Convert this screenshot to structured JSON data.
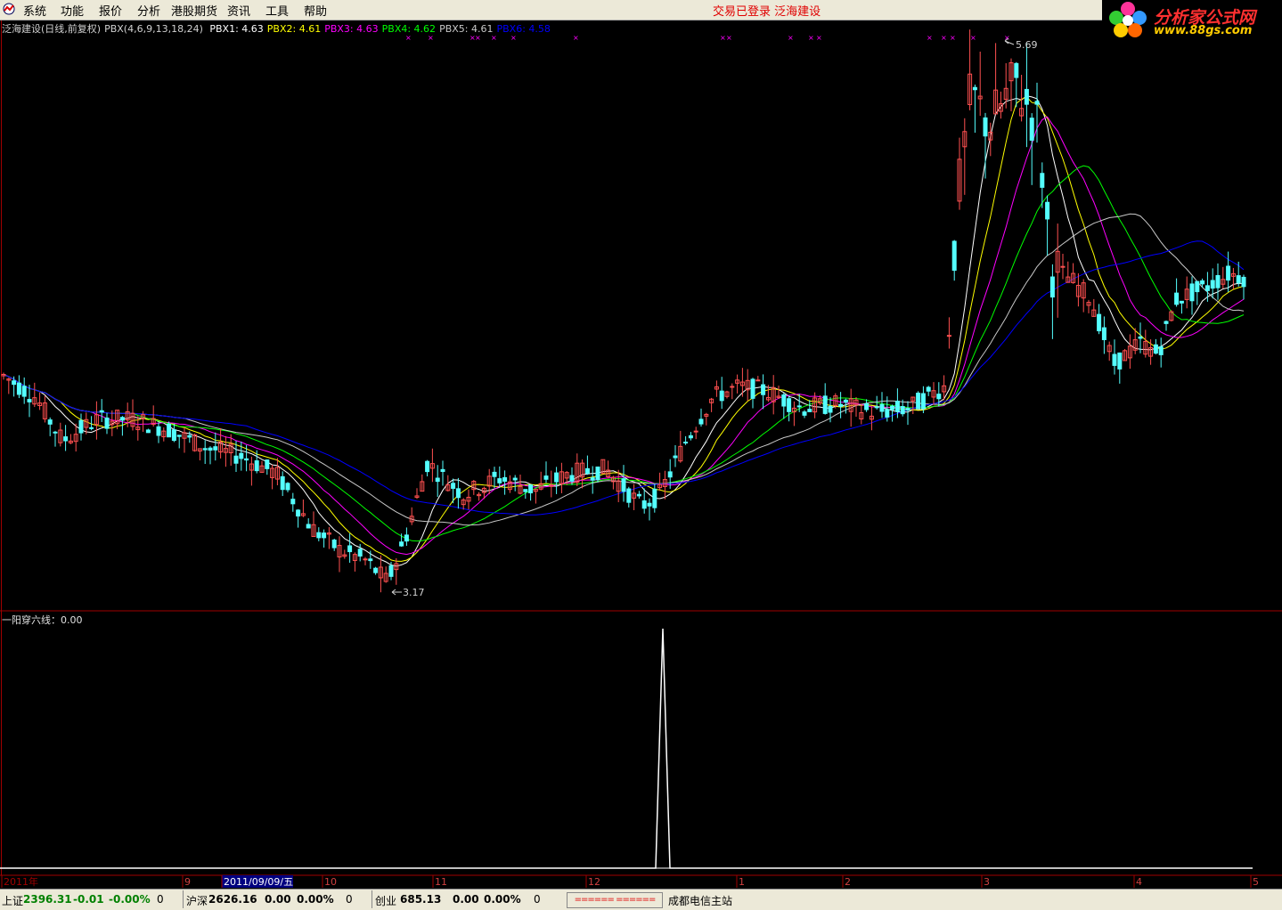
{
  "menu": {
    "items": [
      "系统",
      "功能",
      "报价",
      "分析",
      "港股期货",
      "资讯",
      "工具",
      "帮助"
    ],
    "status": "交易已登录  泛海建设"
  },
  "brand": {
    "name": "分析家公式网",
    "url": "www.88gs.com"
  },
  "indicator": {
    "title": "泛海建设(日线,前复权)",
    "formula": "PBX(4,6,9,13,18,24)",
    "lines": [
      {
        "label": "PBX1:",
        "value": "4.63",
        "color": "#ffffff"
      },
      {
        "label": "PBX2:",
        "value": "4.61",
        "color": "#ffff00"
      },
      {
        "label": "PBX3:",
        "value": "4.63",
        "color": "#ff00ff"
      },
      {
        "label": "PBX4:",
        "value": "4.62",
        "color": "#00ff00"
      },
      {
        "label": "PBX5:",
        "value": "4.61",
        "color": "#c8c8c8"
      },
      {
        "label": "PBX6:",
        "value": "4.58",
        "color": "#0000ff"
      }
    ],
    "high_label": "5.69",
    "low_label": "3.17"
  },
  "sub_indicator": {
    "label": "一阳穿六线：0.00"
  },
  "time_axis": {
    "labels": [
      "2011年",
      "9",
      "2011/09/09/五",
      "10",
      "11",
      "12",
      "1",
      "2",
      "3",
      "4",
      "5"
    ]
  },
  "bottom": {
    "sh": {
      "name": "上证",
      "price": "2396.31",
      "chg": "-0.01",
      "pct": "-0.00%",
      "vol": "0"
    },
    "hs": {
      "name": "沪深",
      "price": "2626.16",
      "chg": "0.00",
      "pct": "0.00%",
      "vol": "0"
    },
    "cy": {
      "name": "创业",
      "price": "685.13",
      "chg": "0.00",
      "pct": "0.00%",
      "vol": "0"
    },
    "dashes": "====== ======",
    "server": "成都电信主站"
  },
  "colors": {
    "up_candle": "#ff5050",
    "down_candle": "#54ffff",
    "grid_red": "#a00000",
    "background": "#000000"
  }
}
